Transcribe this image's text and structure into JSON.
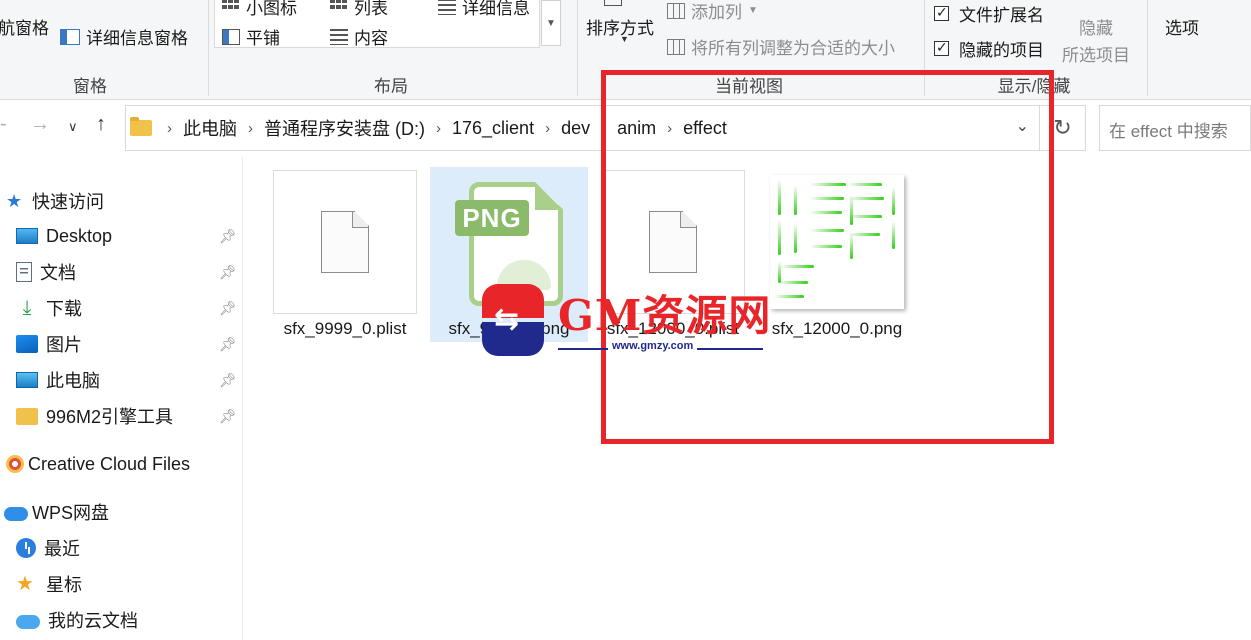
{
  "ribbon": {
    "panes": {
      "nav_pane_label": "航窗格",
      "details_pane_label": "详细信息窗格",
      "group_label": "窗格"
    },
    "layout": {
      "small_icons": "小图标",
      "list": "列表",
      "details": "详细信息",
      "tiles": "平铺",
      "content": "内容",
      "group_label": "布局"
    },
    "current_view": {
      "sort_by": "排序方式",
      "add_column": "添加列",
      "fit_columns": "将所有列调整为合适的大小",
      "group_label": "当前视图"
    },
    "show_hide": {
      "file_ext": "文件扩展名",
      "hidden_items": "隐藏的项目",
      "hide_selected_line1": "隐藏",
      "hide_selected_line2": "所选项目",
      "group_label": "显示/隐藏"
    },
    "options_label": "选项"
  },
  "address": {
    "crumbs": [
      "此电脑",
      "普通程序安装盘 (D:)",
      "176_client",
      "dev",
      "anim",
      "effect"
    ],
    "search_placeholder": "在 effect 中搜索"
  },
  "sidebar": {
    "quick_access": "快速访问",
    "items": [
      {
        "label": "Desktop",
        "icon": "desktop-icon",
        "pinned": true
      },
      {
        "label": "文档",
        "icon": "documents-icon",
        "pinned": true
      },
      {
        "label": "下载",
        "icon": "download-icon",
        "pinned": true
      },
      {
        "label": "图片",
        "icon": "pictures-icon",
        "pinned": true
      },
      {
        "label": "此电脑",
        "icon": "this-pc-icon",
        "pinned": true
      },
      {
        "label": "996M2引擎工具",
        "icon": "folder-icon",
        "pinned": true
      }
    ],
    "creative_cloud": "Creative Cloud Files",
    "wps": "WPS网盘",
    "wps_items": [
      {
        "label": "最近",
        "icon": "recent-icon"
      },
      {
        "label": "星标",
        "icon": "star-icon"
      },
      {
        "label": "我的云文档",
        "icon": "cloud-docs-icon"
      }
    ]
  },
  "files": [
    {
      "name": "sfx_9999_0.plist",
      "type": "blank"
    },
    {
      "name": "sfx_9999_0.png",
      "type": "png",
      "selected": true,
      "badge": "PNG"
    },
    {
      "name": "sfx_12000_0.plist",
      "type": "blank"
    },
    {
      "name": "sfx_12000_0.png",
      "type": "sprite"
    }
  ],
  "watermark": {
    "title": "GM资源网",
    "url": "www.gmzy.com"
  },
  "colors": {
    "annotation_red": "#e8262a",
    "selection": "#dcecfb",
    "accent": "#2d7ad6"
  }
}
